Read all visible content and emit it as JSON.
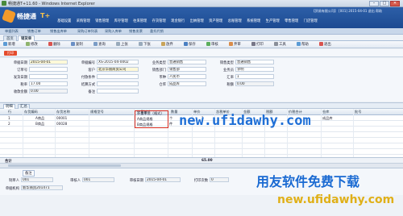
{
  "window": {
    "title": "畅捷通T+11.60 - Windows Internet Explorer",
    "min": "–",
    "max": "□",
    "close": "✕"
  },
  "banner": {
    "logo_text": "畅捷通",
    "logo_suffix": "T+",
    "top_info": "【贸易有限公司】 [001] 2015-04-01 退出 帮助",
    "menu": [
      "基础设置",
      "采购管理",
      "销售管理",
      "库存管理",
      "往来管理",
      "存货管理",
      "现金银行",
      "出纳管理",
      "资产管理",
      "总账管理",
      "系统管理",
      "生产管理",
      "零售管理",
      "门店管理"
    ]
  },
  "nav": [
    "单据列表",
    "销售订单",
    "销售出库单",
    "采购订单列表",
    "采购入库单",
    "销售发票",
    "委托代销"
  ],
  "tabs": [
    "首页",
    "销货单"
  ],
  "toolbar": [
    "新增",
    "修改",
    "删除",
    "复制",
    "查询",
    "上张",
    "下张",
    "放弃",
    "保存",
    "审核",
    "弃审",
    "打印",
    "工具",
    "帮助",
    "退出"
  ],
  "print_label": "打印",
  "form": {
    "fields": [
      {
        "label": "单据日期",
        "value": "2015-04-01"
      },
      {
        "label": "单据编号",
        "value": "XS-2015-04-0002"
      },
      {
        "label": "业务类型",
        "value": "普通销售"
      },
      {
        "label": "销售类型",
        "value": "普通销售"
      },
      {
        "label": "订单号",
        "value": ""
      },
      {
        "label": "客户",
        "value": "北京华丽商贸公司"
      },
      {
        "label": "销售部门",
        "value": "销售部"
      },
      {
        "label": "业务员",
        "value": "李明"
      },
      {
        "label": "发货日期",
        "value": ""
      },
      {
        "label": "付款条件",
        "value": ""
      },
      {
        "label": "币种",
        "value": "人民币"
      },
      {
        "label": "汇率",
        "value": "1"
      },
      {
        "label": "税率",
        "value": "17.00"
      },
      {
        "label": "结算方式",
        "value": ""
      },
      {
        "label": "仓库",
        "value": "成品库"
      },
      {
        "label": "税额",
        "value": "0.00"
      },
      {
        "label": "收款金额",
        "value": "0.00"
      },
      {
        "label": "备注",
        "value": ""
      }
    ]
  },
  "grid": {
    "tabs": [
      "明细",
      "汇总"
    ],
    "headers": [
      "行",
      "存货编码",
      "存货名称",
      "规格型号",
      "计量单位",
      "数量",
      "单价",
      "含税单价",
      "金额",
      "税额",
      "价税合计",
      "仓库",
      "批号"
    ],
    "rows": [
      {
        "n": "1",
        "code": "00001",
        "name": "A商品",
        "unit": "个",
        "qty": "1",
        "price": "",
        "taxprice": "",
        "amount": "",
        "tax": "",
        "total": "",
        "wh": "成品库"
      },
      {
        "n": "2",
        "code": "00028",
        "name": "B商品",
        "unit": "件",
        "qty": "",
        "price": "",
        "taxprice": "",
        "amount": "",
        "tax": "",
        "total": "",
        "wh": ""
      }
    ],
    "highlight_labels": [
      "计量单位（格式）",
      "A商品规格",
      "B商品规格"
    ],
    "total_label": "合计",
    "total_value": "65.00"
  },
  "footer": {
    "tab": "备注",
    "fields": [
      {
        "label": "制单人",
        "value": "001"
      },
      {
        "label": "审核人",
        "value": "001"
      },
      {
        "label": "审核日期",
        "value": "2015-04-01"
      },
      {
        "label": "打印次数",
        "value": "0"
      },
      {
        "label": "单据机构",
        "value": "新华商贸201471"
      }
    ]
  },
  "watermarks": {
    "mid": "new.ufidawhy.com",
    "cn": "用友软件免费下载",
    "url": "new.ufidawhy.com"
  }
}
